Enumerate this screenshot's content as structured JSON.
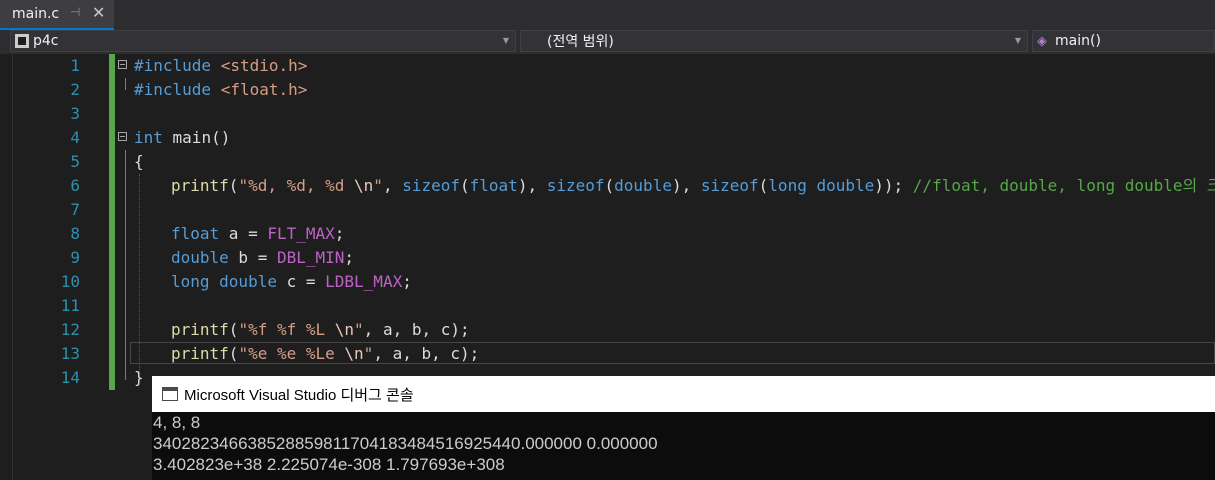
{
  "tab": {
    "title": "main.c",
    "pin_icon": "pin-icon",
    "close_icon": "close-icon"
  },
  "navbar": {
    "project": "p4c",
    "scope": "(전역 범위)",
    "function": "main()"
  },
  "editor": {
    "line_numbers": [
      "1",
      "2",
      "3",
      "4",
      "5",
      "6",
      "7",
      "8",
      "9",
      "10",
      "11",
      "12",
      "13",
      "14"
    ],
    "current_line": 13
  },
  "code": {
    "l1_directive": "#include",
    "l1_header": "<stdio.h>",
    "l2_directive": "#include",
    "l2_header": "<float.h>",
    "l4_type": "int",
    "l4_rest": " main()",
    "l5": "{",
    "l6_fn": "printf",
    "l6_open": "(",
    "l6_str1": "\"%d, %d, %d ",
    "l6_esc": "\\n",
    "l6_str2": "\"",
    "l6_sep1": ", ",
    "l6_sizeof1": "sizeof",
    "l6_p1a": "(",
    "l6_t1": "float",
    "l6_p1b": "), ",
    "l6_sizeof2": "sizeof",
    "l6_p2a": "(",
    "l6_t2": "double",
    "l6_p2b": "), ",
    "l6_sizeof3": "sizeof",
    "l6_p3a": "(",
    "l6_t3": "long double",
    "l6_p3b": ")); ",
    "l6_comment": "//float, double, long double의 크기",
    "l8_type": "float",
    "l8_mid": " a = ",
    "l8_macro": "FLT_MAX",
    "l8_end": ";",
    "l9_type": "double",
    "l9_mid": " b = ",
    "l9_macro": "DBL_MIN",
    "l9_end": ";",
    "l10_type": "long double",
    "l10_mid": " c = ",
    "l10_macro": "LDBL_MAX",
    "l10_end": ";",
    "l12_fn": "printf",
    "l12_open": "(",
    "l12_str1": "\"%f %f %L ",
    "l12_esc": "\\n",
    "l12_str2": "\"",
    "l12_rest": ", a, b, c);",
    "l13_fn": "printf",
    "l13_open": "(",
    "l13_str1": "\"%e %e %Le ",
    "l13_esc": "\\n",
    "l13_str2": "\"",
    "l13_rest": ", a, b, c);",
    "l14": "}"
  },
  "console": {
    "title": "Microsoft Visual Studio 디버그 콘솔",
    "lines": [
      "4, 8, 8",
      "340282346638528859811704183484516925440.000000 0.000000",
      "3.402823e+38 2.225074e-308 1.797693e+308"
    ]
  },
  "colors": {
    "background": "#1e1e1e",
    "keyword": "#569cd6",
    "string": "#d69d85",
    "macro": "#bd63c5",
    "comment": "#57a64a",
    "line_number": "#2b91af",
    "change_margin": "#57a64a"
  }
}
